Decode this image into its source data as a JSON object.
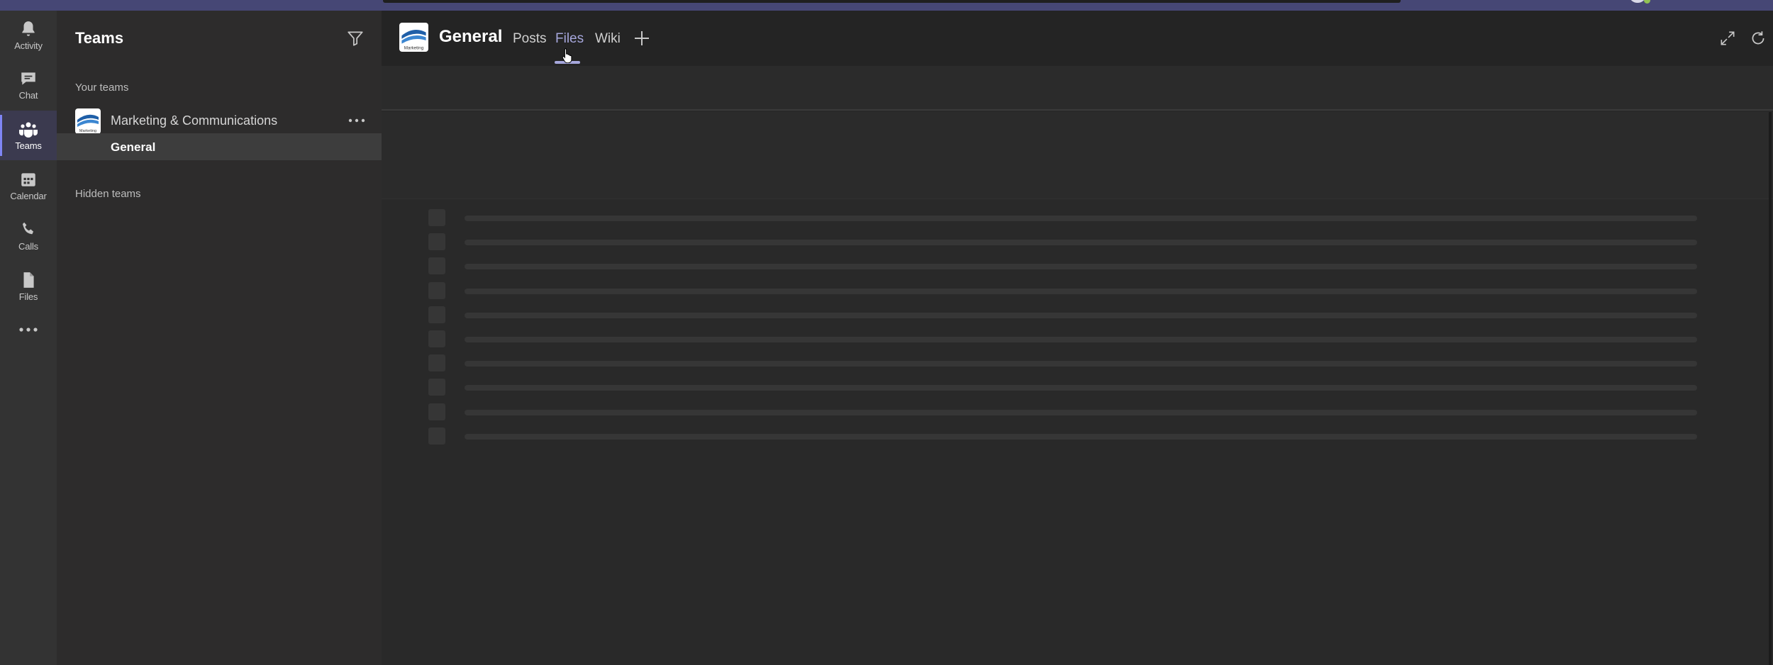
{
  "rail": {
    "items": [
      {
        "label": "Activity",
        "icon": "bell-icon"
      },
      {
        "label": "Chat",
        "icon": "chat-icon"
      },
      {
        "label": "Teams",
        "icon": "teams-icon",
        "active": true
      },
      {
        "label": "Calendar",
        "icon": "calendar-icon"
      },
      {
        "label": "Calls",
        "icon": "phone-icon"
      },
      {
        "label": "Files",
        "icon": "file-icon"
      }
    ],
    "more_icon": "more-apps-icon"
  },
  "pane": {
    "title": "Teams",
    "filter_icon": "filter-icon",
    "your_teams_label": "Your teams",
    "team": {
      "name": "Marketing & Communications",
      "logo_text": "Marketing",
      "channel": "General"
    },
    "hidden_teams_label": "Hidden teams"
  },
  "header": {
    "channel_title": "General",
    "logo_text": "Marketing",
    "tabs": [
      {
        "label": "Posts"
      },
      {
        "label": "Files",
        "selected": true
      },
      {
        "label": "Wiki"
      }
    ],
    "add_tab_icon": "plus-icon",
    "expand_icon": "expand-icon",
    "refresh_icon": "refresh-icon"
  },
  "files_view": {
    "state": "loading",
    "placeholder_rows": 10
  },
  "colors": {
    "accent": "#7f85f5",
    "selected_tab": "#a6a7dc",
    "top_bar": "#464775",
    "presence": "#92c353"
  }
}
